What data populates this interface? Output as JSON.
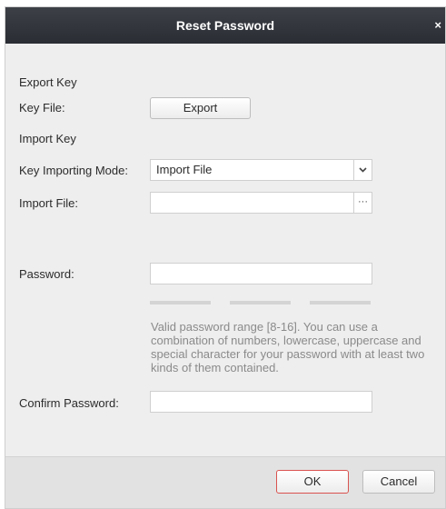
{
  "dialog": {
    "title": "Reset Password",
    "close_glyph": "×"
  },
  "export_key": {
    "section_title": "Export Key",
    "key_file_label": "Key File:",
    "export_button": "Export"
  },
  "import_key": {
    "section_title": "Import Key",
    "mode_label": "Key Importing Mode:",
    "mode_value": "Import File",
    "mode_dropdown_icon": "chevron-down-icon",
    "file_label": "Import File:",
    "file_value": "",
    "browse_glyph": "···"
  },
  "password": {
    "label": "Password:",
    "value": "",
    "strength_levels": 3,
    "hint": "Valid password range [8-16]. You can use a combination of numbers, lowercase, uppercase and special character for your password with at least two kinds of them contained."
  },
  "confirm_password": {
    "label": "Confirm Password:",
    "value": ""
  },
  "buttons": {
    "ok": "OK",
    "cancel": "Cancel"
  },
  "colors": {
    "titlebar": "#2f3238",
    "body": "#eeeeee",
    "ok_border": "#d9534f"
  }
}
